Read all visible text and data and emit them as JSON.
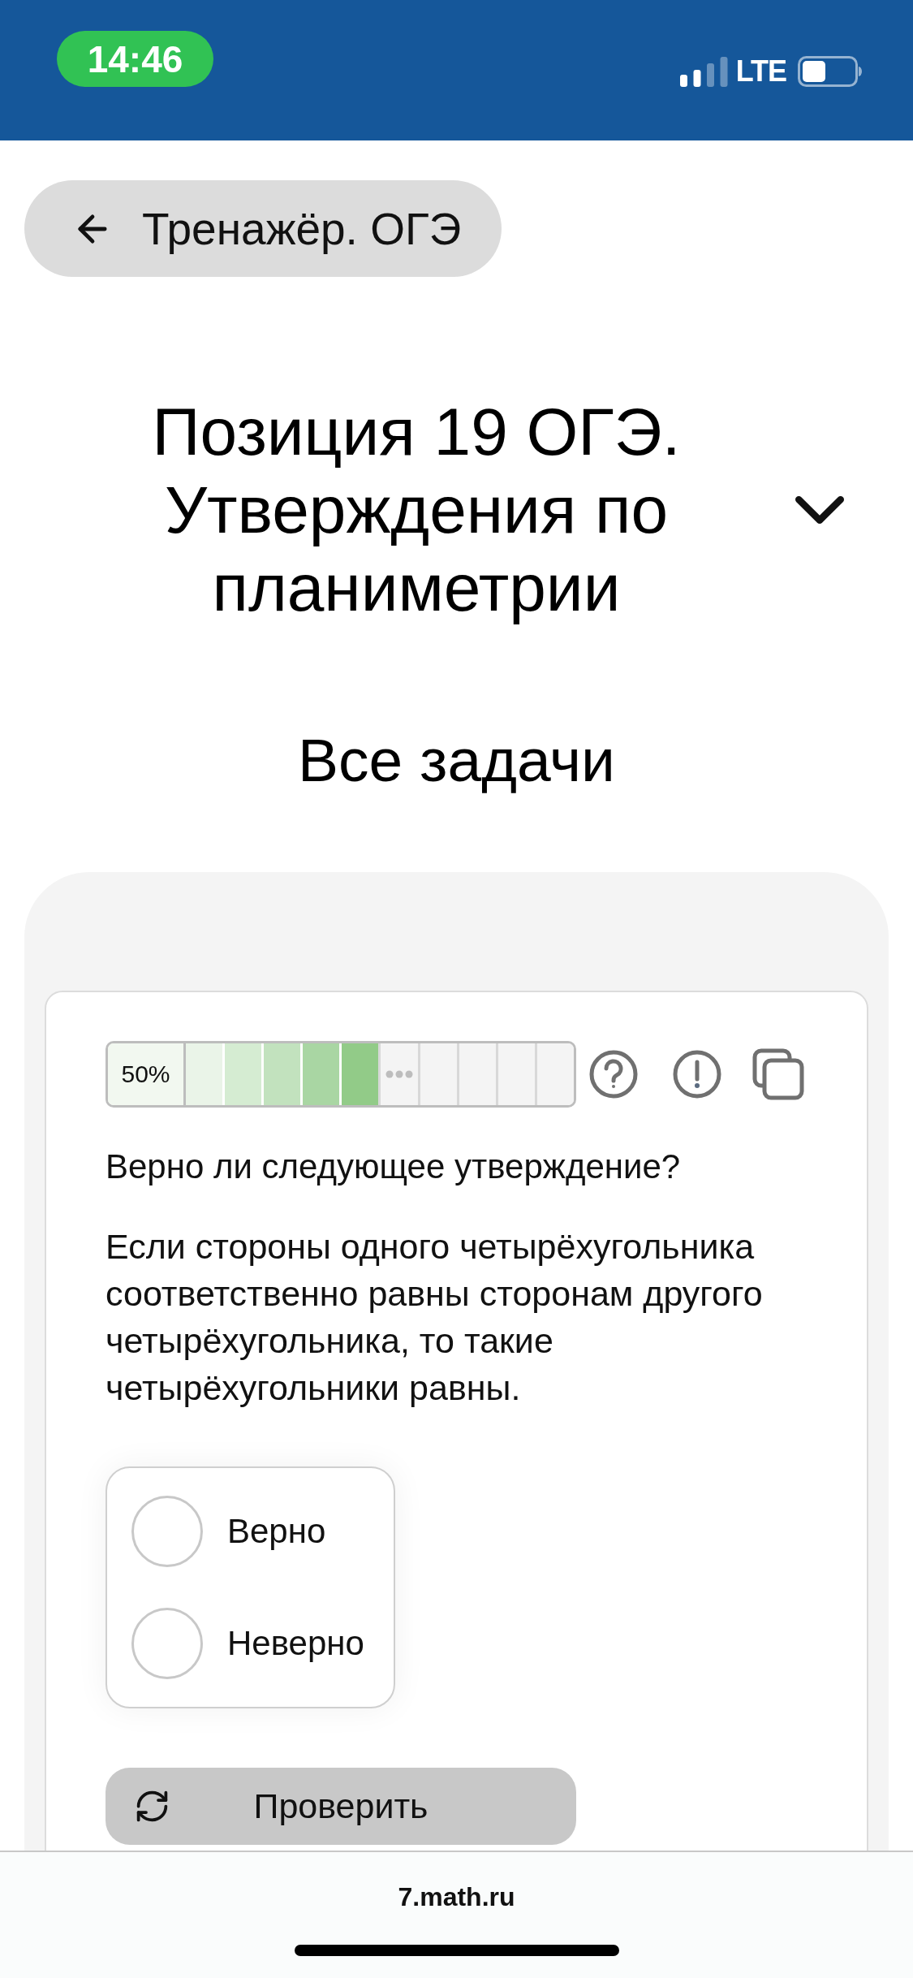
{
  "status_bar": {
    "time": "14:46",
    "network": "LTE"
  },
  "back_button": {
    "label": "Тренажёр. ОГЭ"
  },
  "header": {
    "title": "Позиция 19 ОГЭ. Утверждения по планиметрии",
    "expanded": false
  },
  "section_title": "Все задачи",
  "task": {
    "progress": {
      "label": "50%",
      "cells": [
        {
          "kind": "attempt",
          "color": "#eaf4e8"
        },
        {
          "kind": "attempt",
          "color": "#d5ecd2"
        },
        {
          "kind": "attempt",
          "color": "#c2e2be"
        },
        {
          "kind": "attempt",
          "color": "#a9d6a3"
        },
        {
          "kind": "attempt",
          "color": "#92cb88"
        },
        {
          "kind": "more"
        },
        {
          "kind": "empty"
        },
        {
          "kind": "empty"
        },
        {
          "kind": "empty"
        },
        {
          "kind": "empty"
        }
      ]
    },
    "question": "Верно ли следующее утверждение?",
    "statement": "Если стороны одного четырёхугольника соответственно равны сторонам другого четырёхугольника, то такие четырёхугольники равны.",
    "options": [
      {
        "label": "Верно",
        "selected": false
      },
      {
        "label": "Неверно",
        "selected": false
      }
    ],
    "check_button": {
      "label": "Проверить"
    }
  },
  "browser_bar": {
    "url": "7.math.ru"
  }
}
